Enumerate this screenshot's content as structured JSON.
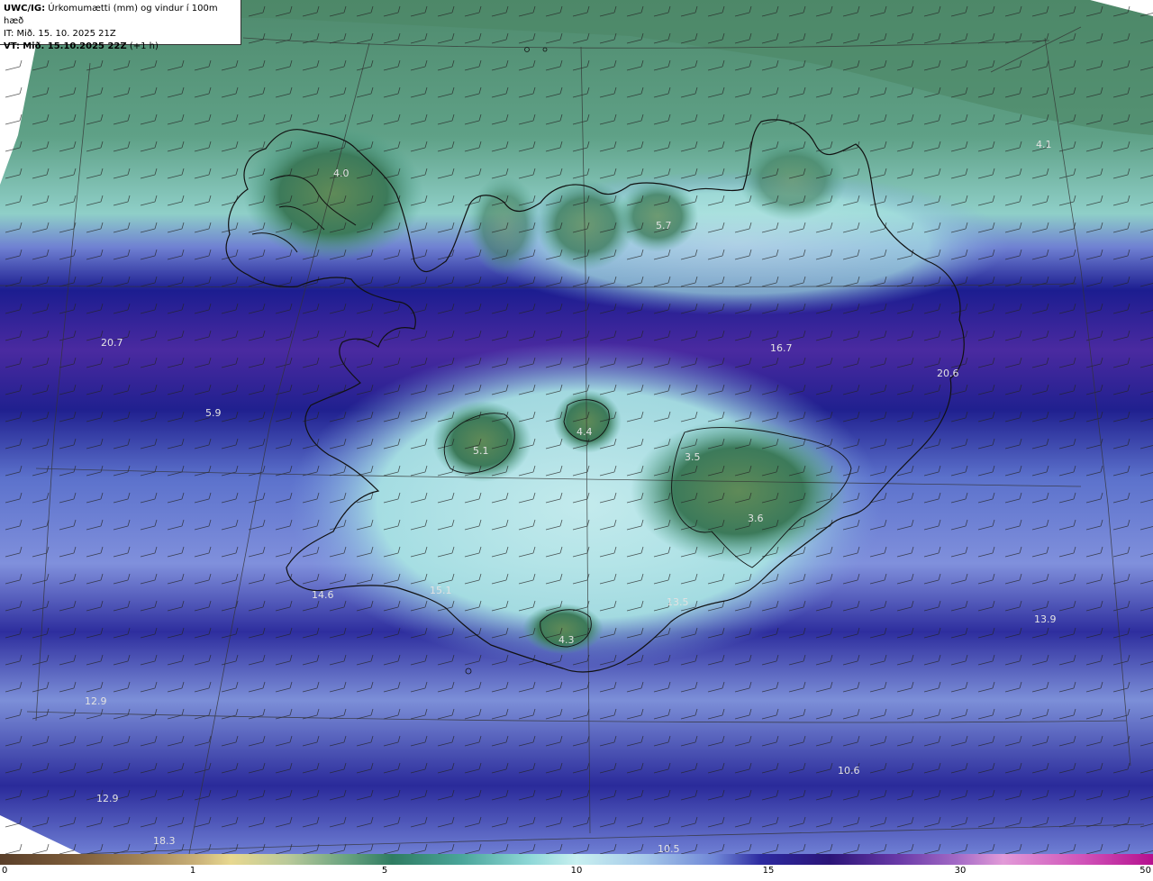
{
  "header": {
    "product": "UWC/IG:",
    "title": "Úrkomumætti (mm) og vindur í 100m hæð",
    "it_line": "IT: Mið. 15. 10. 2025 21Z",
    "vt_prefix": "VT:",
    "vt_bold": "Mið. 15.10.2025 22Z",
    "vt_suffix": "(+1 h)"
  },
  "colorbar": {
    "ticks": [
      "0",
      "1",
      "5",
      "10",
      "15",
      "30",
      "50"
    ]
  },
  "values": [
    "4.0",
    "4.1",
    "5.7",
    "20.7",
    "16.7",
    "20.6",
    "5.9",
    "5.1",
    "4.4",
    "3.5",
    "3.6",
    "14.6",
    "15.1",
    "13.5",
    "4.3",
    "13.9",
    "12.9",
    "12.9",
    "18.3",
    "10.6",
    "10.5"
  ],
  "colors": {
    "low_band": "#3c6f55",
    "mid_band": "#5a9e88",
    "light_band": "#a9e4e2",
    "high_band": "#1f1f8f",
    "very_high_band": "#4a2aa0",
    "ocean_south": "#7f95d8",
    "coastline": "#111111"
  }
}
